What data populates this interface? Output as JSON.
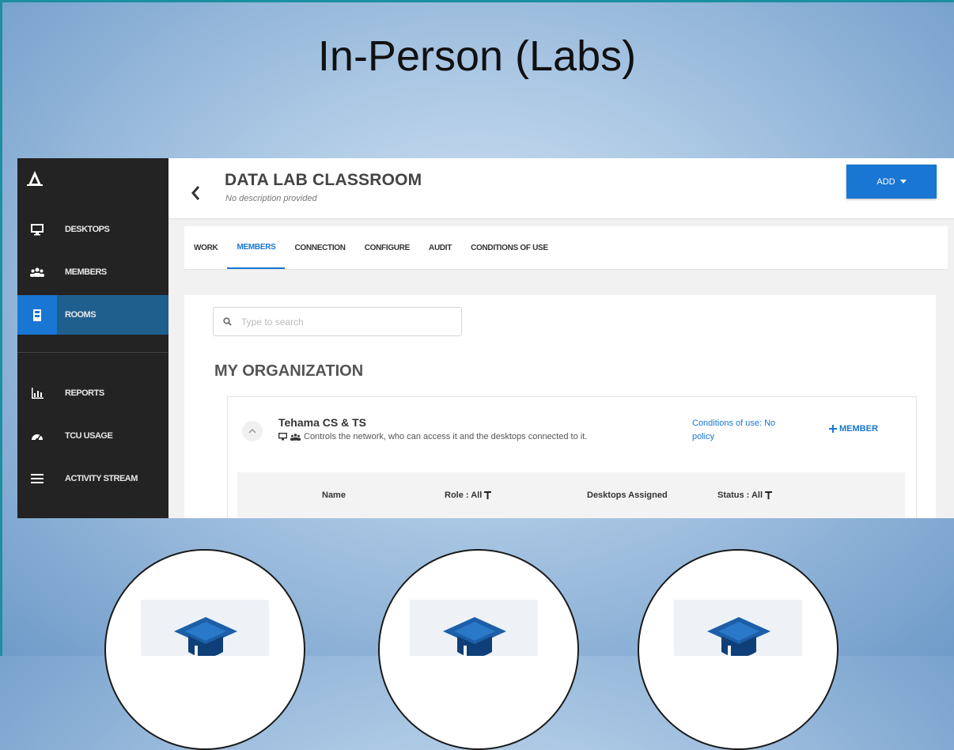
{
  "slide": {
    "title": "In-Person (Labs)"
  },
  "sidebar": {
    "items": [
      {
        "label": "DESKTOPS",
        "icon": "monitor-icon"
      },
      {
        "label": "MEMBERS",
        "icon": "members-icon"
      },
      {
        "label": "ROOMS",
        "icon": "room-icon",
        "active": true
      },
      {
        "label": "REPORTS",
        "icon": "chart-icon"
      },
      {
        "label": "TCU USAGE",
        "icon": "gauge-icon"
      },
      {
        "label": "ACTIVITY STREAM",
        "icon": "list-icon"
      }
    ]
  },
  "header": {
    "title": "DATA LAB CLASSROOM",
    "description": "No description provided",
    "add_label": "ADD"
  },
  "tabs": [
    {
      "label": "WORK"
    },
    {
      "label": "MEMBERS",
      "active": true
    },
    {
      "label": "CONNECTION"
    },
    {
      "label": "CONFIGURE"
    },
    {
      "label": "AUDIT"
    },
    {
      "label": "CONDITIONS OF USE"
    }
  ],
  "search": {
    "placeholder": "Type to search"
  },
  "organization": {
    "title": "MY ORGANIZATION",
    "group": {
      "name": "Tehama CS & TS",
      "description": "Controls the network, who can access it and the desktops connected to it.",
      "conditions": "Conditions of use: No policy",
      "add_member_label": "MEMBER"
    },
    "table_headers": {
      "name": "Name",
      "role": "Role : All",
      "desktops": "Desktops Assigned",
      "status": "Status : All"
    }
  },
  "colors": {
    "accent": "#1976d2",
    "sidebar": "#232323",
    "sidebar_active": "#1f5f8e"
  }
}
